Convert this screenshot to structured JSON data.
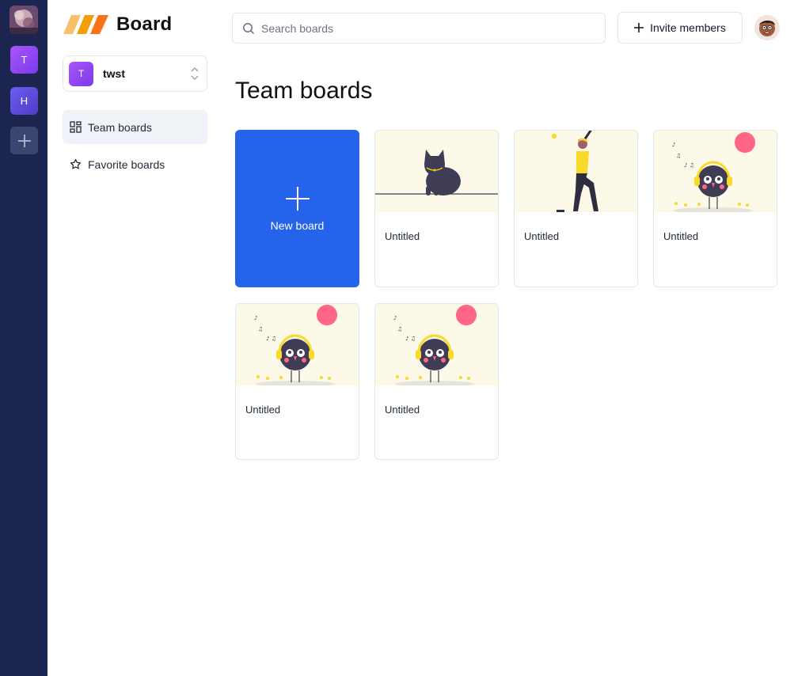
{
  "app": {
    "logo_text": "Board"
  },
  "rail": {
    "orgs": [
      {
        "initial": "T",
        "color": "#8b5cf6"
      },
      {
        "initial": "H",
        "color": "#5b4fd8"
      }
    ]
  },
  "org_switcher": {
    "initial": "T",
    "name": "twst"
  },
  "sidebar": {
    "items": [
      {
        "label": "Team boards",
        "icon": "dashboard-icon",
        "active": true
      },
      {
        "label": "Favorite boards",
        "icon": "star-icon",
        "active": false
      }
    ]
  },
  "header": {
    "search_placeholder": "Search boards",
    "invite_label": "Invite members"
  },
  "main": {
    "title": "Team boards",
    "new_board_label": "New board",
    "boards": [
      {
        "title": "Untitled",
        "illustration": "cat"
      },
      {
        "title": "Untitled",
        "illustration": "baseball-player"
      },
      {
        "title": "Untitled",
        "illustration": "bird-headphones"
      },
      {
        "title": "Untitled",
        "illustration": "bird-headphones"
      },
      {
        "title": "Untitled",
        "illustration": "bird-headphones"
      }
    ]
  },
  "colors": {
    "rail_bg": "#1b2550",
    "accent": "#2563eb",
    "card_art_bg": "#fdf9e9"
  }
}
